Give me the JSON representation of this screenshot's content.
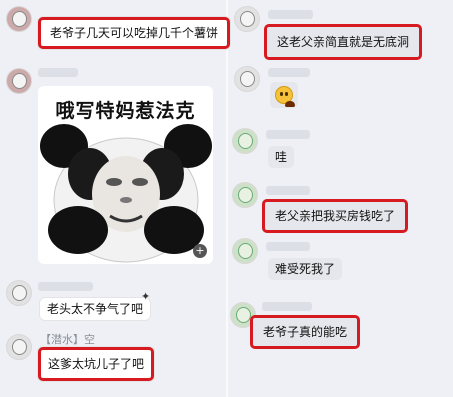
{
  "left_messages": [
    {
      "text": "老爷子几天可以吃掉几千个薯饼"
    },
    {
      "text": "老头太不争气了吧"
    },
    {
      "text": "这爹太坑儿子了吧"
    }
  ],
  "meme": {
    "caption": "哦写特妈惹法克"
  },
  "sender_tag": "【潜水】空",
  "right_messages": [
    {
      "text": "这老父亲简直就是无底洞"
    },
    {
      "text": "哇"
    },
    {
      "text": "老父亲把我买房钱吃了"
    },
    {
      "text": "难受死我了"
    },
    {
      "text": "老爷子真的能吃"
    }
  ],
  "icons": {
    "sticker": "crying-face-emoji",
    "meme_plus": "plus-icon",
    "decoration": "sparkle-icon"
  },
  "colors": {
    "highlight": "#d71920",
    "background": "#eef0f5",
    "bubble": "#ffffff"
  }
}
